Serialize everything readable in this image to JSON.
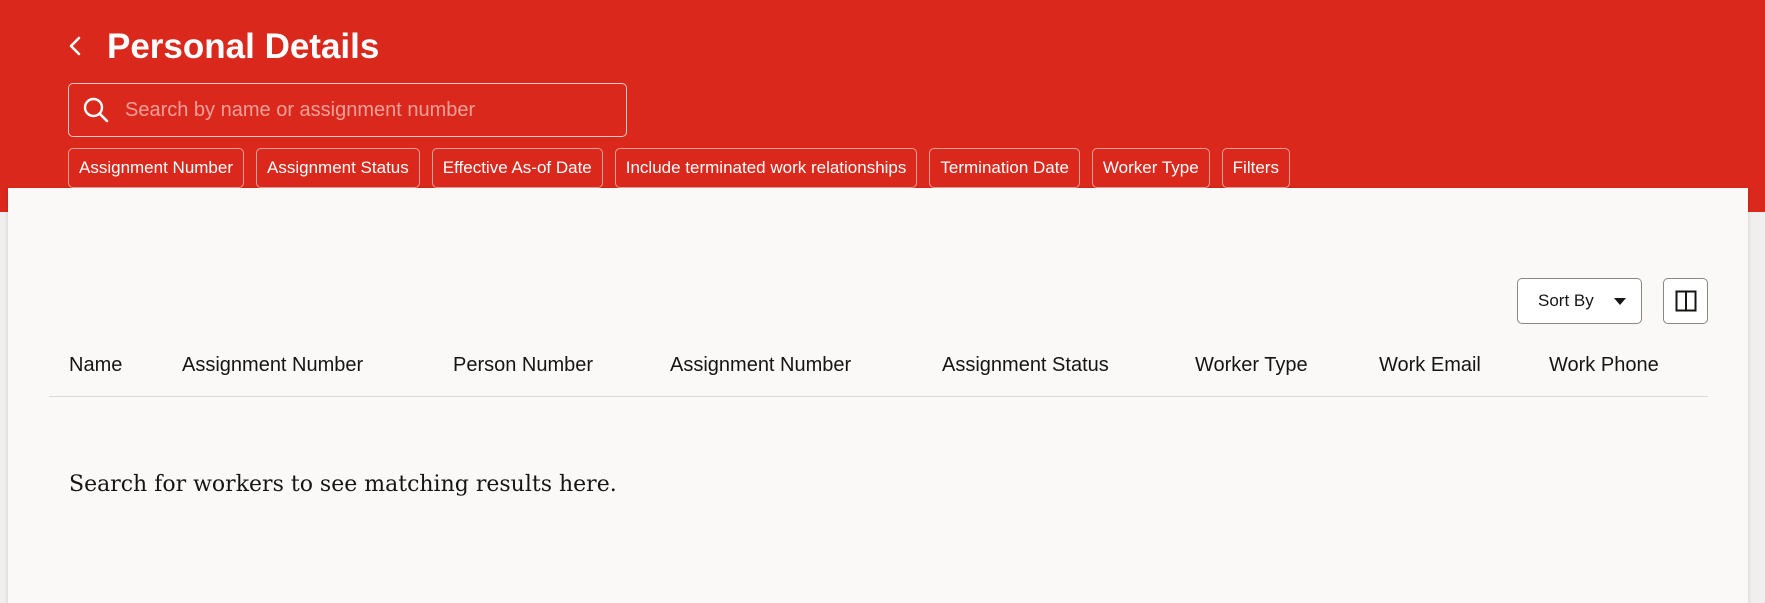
{
  "header": {
    "title": "Personal Details",
    "search_placeholder": "Search by name or assignment number",
    "filter_chips": [
      "Assignment Number",
      "Assignment Status",
      "Effective As-of Date",
      "Include terminated work relationships",
      "Termination Date",
      "Worker Type",
      "Filters"
    ]
  },
  "toolbar": {
    "sort_label": "Sort By"
  },
  "table": {
    "columns": [
      "Name",
      "Assignment Number",
      "Person Number",
      "Assignment Number",
      "Assignment Status",
      "Worker Type",
      "Work Email",
      "Work Phone"
    ],
    "empty_message": "Search for workers to see matching results here."
  },
  "colors": {
    "brand_red": "#da291c",
    "page_background": "#faf9f8",
    "text_dark": "#161513"
  },
  "icons": {
    "back": "chevron-left-icon",
    "search": "search-icon",
    "sort": "caret-down-icon",
    "columns": "split-view-icon"
  }
}
